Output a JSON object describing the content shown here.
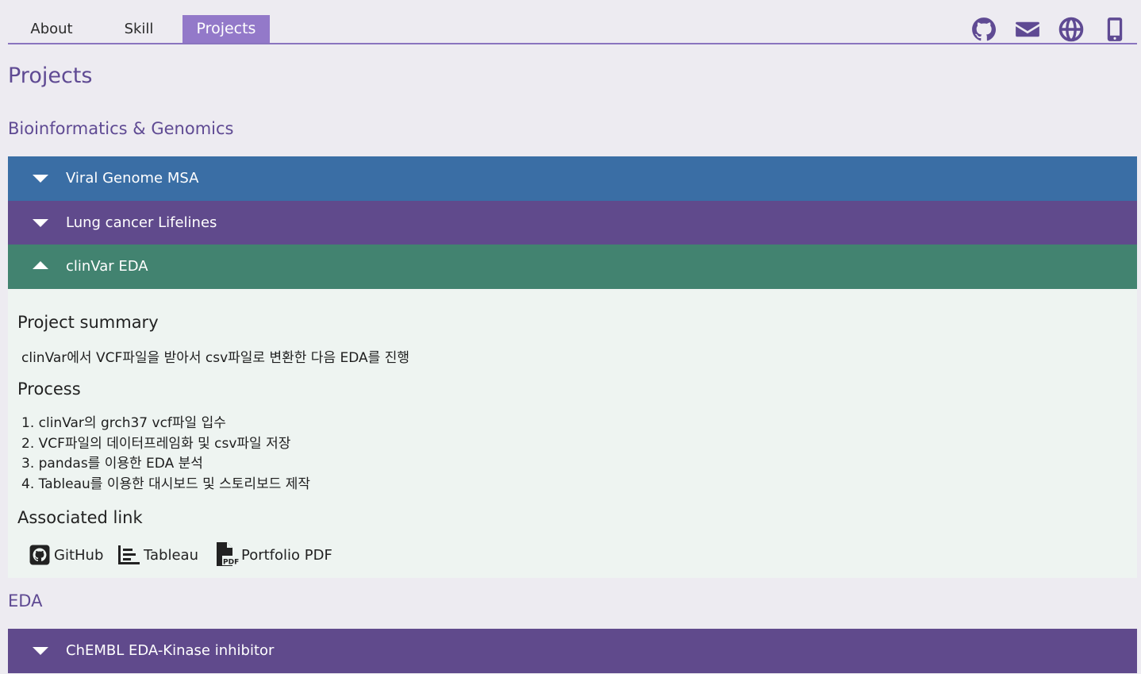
{
  "nav": {
    "tabs": [
      {
        "label": "About",
        "active": false
      },
      {
        "label": "Skill",
        "active": false
      },
      {
        "label": "Projects",
        "active": true
      }
    ],
    "icons": [
      "github-icon",
      "mail-icon",
      "globe-icon",
      "mobile-icon"
    ]
  },
  "page": {
    "title": "Projects"
  },
  "sections": [
    {
      "title": "Bioinformatics & Genomics",
      "items": [
        {
          "title": "Viral Genome MSA",
          "expanded": false,
          "color": "#3a6ea5"
        },
        {
          "title": "Lung cancer Lifelines",
          "expanded": false,
          "color": "#604a8c"
        },
        {
          "title": "clinVar EDA",
          "expanded": true,
          "color": "#428370"
        }
      ]
    },
    {
      "title": "EDA",
      "items": [
        {
          "title": "ChEMBL EDA-Kinase inhibitor",
          "expanded": false,
          "color": "#604a8c"
        }
      ]
    }
  ],
  "detail": {
    "summary_heading": "Project summary",
    "summary_text": "clinVar에서 VCF파일을 받아서 csv파일로 변환한 다음 EDA를 진행",
    "process_heading": "Process",
    "process_steps": [
      "1. clinVar의 grch37 vcf파일 입수",
      "2. VCF파일의 데이터프레임화 및 csv파일 저장",
      "3. pandas를 이용한 EDA 분석",
      "4. Tableau를 이용한 대시보드 및 스토리보드 제작"
    ],
    "links_heading": "Associated link",
    "links": [
      {
        "label": "GitHub",
        "icon": "github-square-icon"
      },
      {
        "label": "Tableau",
        "icon": "chart-icon"
      },
      {
        "label": "Portfolio PDF",
        "icon": "pdf-file-icon"
      }
    ]
  },
  "colors": {
    "background": "#edebf1",
    "accent_purple": "#9379c9",
    "heading_purple": "#5f4a93",
    "row_blue": "#3a6ea5",
    "row_purple": "#604a8c",
    "row_green": "#428370",
    "panel_bg": "#eef4f1"
  }
}
